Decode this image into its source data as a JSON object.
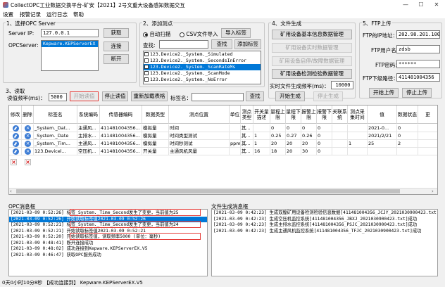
{
  "window": {
    "title": "CollectOPC工业数据交换平台-矿安【2021】2号文重大设备感知数据交互",
    "min": "—",
    "max": "☐",
    "close": "✕"
  },
  "menu": [
    "设置",
    "报警记录",
    "运行日志",
    "帮助"
  ],
  "opc": {
    "title": "1、选择OPC Server",
    "ip_label": "Server IP:",
    "ip_value": "127.0.0.1",
    "get_btn": "获取",
    "server_label": "OPCServer:",
    "server_selected": "Kepware.KEPServerEX",
    "connect_btn": "连接",
    "disconnect_btn": "断开"
  },
  "points": {
    "title": "2、添加测点",
    "auto_scan": "自动扫描",
    "csv_import": "CSV文件导入",
    "import_tag_btn": "导入标签",
    "search_label": "查找:",
    "search_btn": "查找",
    "add_tag_btn": "添加标签",
    "items": [
      "123.Device2._System._Simulated",
      "123.Device2._System._SecondsInError",
      "123.Device2._System._ScanRateMs",
      "123.Device2._System._ScanMode",
      "123.Device2._System._NoError"
    ]
  },
  "files": {
    "title": "4、文件生成",
    "buttons": [
      "矿用设备基本信息数据管理",
      "矿用设备实时数据管理",
      "矿用设备启停/故障数据管理",
      "矿用设备检测检验数据管理"
    ],
    "period_label": "实时文件生成频率(ms)：",
    "period_value": "10000",
    "start_btn": "开始生成",
    "stop_btn": "停止生成"
  },
  "ftp": {
    "title": "5、FTP上传",
    "addr_label": "FTP的IP地址：",
    "addr_value": "202.98.201.100",
    "user_label": "FTP用户名：",
    "user_value": "zdsb",
    "pwd_label": "FTP密码：",
    "pwd_value": "******",
    "dir_label": "FTP下级路径：",
    "dir_value": "411481004356",
    "start_btn": "开始上传",
    "stop_btn": "停止上传"
  },
  "read": {
    "title": "3、读取",
    "freq_label": "读值频率(ms)：",
    "freq_value": "5000",
    "start_btn": "开始读值",
    "stop_btn": "停止读值",
    "reload_btn": "重新加载表格",
    "tag_label": "标签名：",
    "search_btn": "查找"
  },
  "grid": {
    "columns": [
      "修改",
      "删除",
      "标签名",
      "系统编码",
      "传感器编码",
      "数据类型",
      "测点位置",
      "单位",
      "测点类型",
      "开关量描述",
      "量程上限",
      "量程下限",
      "报警上限",
      "报警下限",
      "关联系统",
      "测点采集时间",
      "值",
      "数据状态",
      "更"
    ],
    "rows": [
      [
        "",
        "",
        "_System._Dat...",
        "主通风...",
        "411481004356...",
        "模拟量",
        "时间",
        "",
        "其...",
        "",
        "0",
        "0",
        "0",
        "0",
        "",
        "",
        "2021-0...",
        "0",
        ""
      ],
      [
        "",
        "",
        "_System._Date",
        "主排水...",
        "411481004356...",
        "模拟量",
        "时间类型测试",
        "",
        "其...",
        "1",
        "0.25",
        "0.27",
        "0.26",
        "0",
        "",
        "",
        "2021/2/21",
        "0",
        ""
      ],
      [
        "",
        "",
        "_System._Tim...",
        "主通风...",
        "411481004356...",
        "模拟量",
        "时间秒测试",
        "ppm",
        "其...",
        "1",
        "20",
        "20",
        "20",
        "0",
        "",
        "1",
        "25",
        "2",
        ""
      ],
      [
        "",
        "",
        "123.Devicel...",
        "空压机...",
        "411481004356...",
        "开关量",
        "主通风机风量",
        "",
        "其...",
        "16",
        "18",
        "20",
        "30",
        "0",
        "",
        "",
        "",
        "",
        ""
      ]
    ]
  },
  "log_opc": {
    "title": "OPC消息框",
    "lines": [
      "[2021-03-09 0:52:26]  标签_System._Time_Second发生了变更，当前值为25",
      "[2021-03-09 0:52:26]  开始读取标签值2021-03-09 0:52:26",
      "[2021-03-09 0:52:21]  标签_System._Time_Second发生了变更，当前值为24",
      "[2021-03-09 0:52:21]  开始读取标签值2021-03-09 0:52:21",
      "[2021-03-09 0:52:20]  开始读取标签值，读取频率5000 (单位：毫秒)",
      "[2021-03-09 0:48:41]  断开连接成功",
      "[2021-03-09 0:48:02]  成功连接到Kepware.KEPServerEX.V5",
      "[2021-03-09 0:46:47]  获取OPC服务成功"
    ]
  },
  "log_file": {
    "title": "文件生成消息框",
    "lines": [
      "[2021-03-09 0:42:23]  生成双膛矿用设备检测检验信息数据[411481004356_JCJY_2021030900423.txt]成功",
      "[2021-03-09 0:42:23]  生成空压机监控系统[411481004356_JBXJ_2021030900423.txt]成功",
      "[2021-03-09 0:42:23]  生成主排水监控系统[411481004356_PSJC_2021030900423.txt]成功",
      "[2021-03-09 0:42:23]  生成主通风机监控系统[411481004356_TFJC_2021030900423.txt]成功"
    ]
  },
  "status": "0天0小时10分8秒  【成功连接到】 Kepware.KEPServerEX.V5"
}
